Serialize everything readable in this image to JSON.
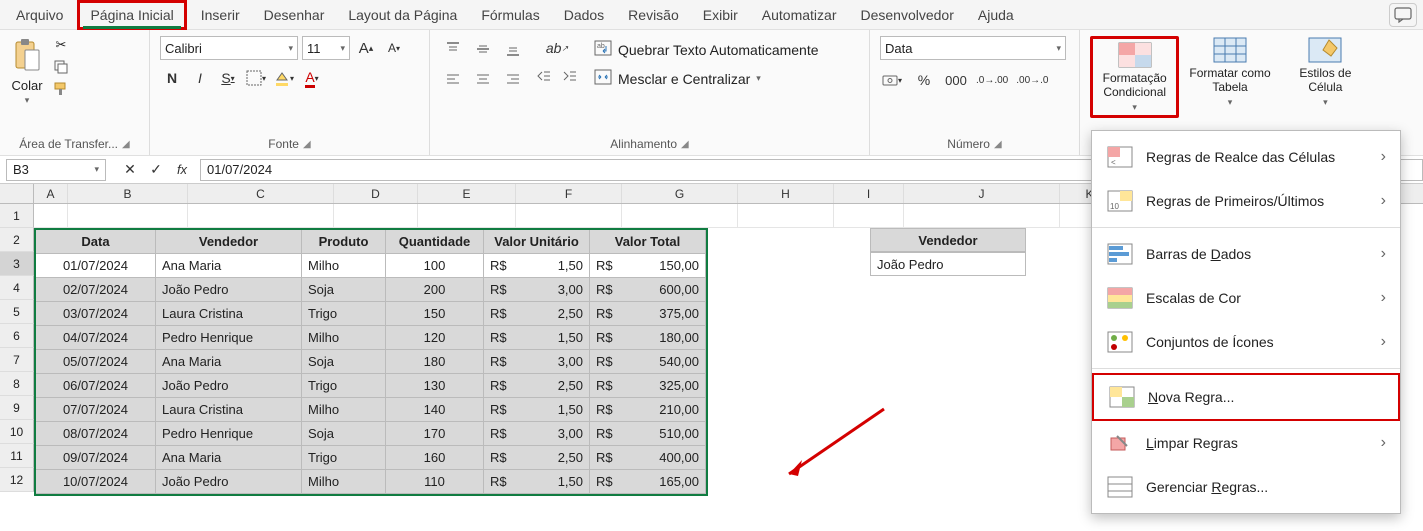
{
  "menu": {
    "items": [
      "Arquivo",
      "Página Inicial",
      "Inserir",
      "Desenhar",
      "Layout da Página",
      "Fórmulas",
      "Dados",
      "Revisão",
      "Exibir",
      "Automatizar",
      "Desenvolvedor",
      "Ajuda"
    ],
    "active_index": 1
  },
  "ribbon": {
    "clipboard": {
      "paste": "Colar",
      "group": "Área de Transfer..."
    },
    "font": {
      "name": "Calibri",
      "size": "11",
      "group": "Fonte"
    },
    "alignment": {
      "wrap": "Quebrar Texto Automaticamente",
      "merge": "Mesclar e Centralizar",
      "group": "Alinhamento"
    },
    "number": {
      "format": "Data",
      "group": "Número"
    },
    "styles": {
      "cond": "Formatação Condicional",
      "table": "Formatar como Tabela",
      "cell": "Estilos de Célula"
    }
  },
  "cf_menu": {
    "highlight": "Regras de Realce das Células",
    "toprules": "Regras de Primeiros/Últimos",
    "databars_pre": "Barras de ",
    "databars_m": "D",
    "databars_post": "ados",
    "scales": "Escalas de Cor",
    "icons": "Conjuntos de Ícones",
    "newrule_m": "N",
    "newrule_post": "ova Regra...",
    "clear_m": "L",
    "clear_post": "impar Regras",
    "manage_pre": "Gerenciar ",
    "manage_m": "R",
    "manage_post": "egras..."
  },
  "formula_bar": {
    "cell_ref": "B3",
    "value": "01/07/2024"
  },
  "columns": [
    "A",
    "B",
    "C",
    "D",
    "E",
    "F",
    "G",
    "H",
    "I",
    "J",
    "K"
  ],
  "row_count": 12,
  "table": {
    "headers": [
      "Data",
      "Vendedor",
      "Produto",
      "Quantidade",
      "Valor Unitário",
      "Valor Total"
    ],
    "currency": "R$",
    "rows": [
      {
        "d": "01/07/2024",
        "v": "Ana Maria",
        "p": "Milho",
        "q": "100",
        "u": "1,50",
        "t": "150,00",
        "white": true
      },
      {
        "d": "02/07/2024",
        "v": "João Pedro",
        "p": "Soja",
        "q": "200",
        "u": "3,00",
        "t": "600,00"
      },
      {
        "d": "03/07/2024",
        "v": "Laura Cristina",
        "p": "Trigo",
        "q": "150",
        "u": "2,50",
        "t": "375,00"
      },
      {
        "d": "04/07/2024",
        "v": "Pedro Henrique",
        "p": "Milho",
        "q": "120",
        "u": "1,50",
        "t": "180,00"
      },
      {
        "d": "05/07/2024",
        "v": "Ana Maria",
        "p": "Soja",
        "q": "180",
        "u": "3,00",
        "t": "540,00"
      },
      {
        "d": "06/07/2024",
        "v": "João Pedro",
        "p": "Trigo",
        "q": "130",
        "u": "2,50",
        "t": "325,00"
      },
      {
        "d": "07/07/2024",
        "v": "Laura Cristina",
        "p": "Milho",
        "q": "140",
        "u": "1,50",
        "t": "210,00"
      },
      {
        "d": "08/07/2024",
        "v": "Pedro Henrique",
        "p": "Soja",
        "q": "170",
        "u": "3,00",
        "t": "510,00"
      },
      {
        "d": "09/07/2024",
        "v": "Ana Maria",
        "p": "Trigo",
        "q": "160",
        "u": "2,50",
        "t": "400,00"
      },
      {
        "d": "10/07/2024",
        "v": "João Pedro",
        "p": "Milho",
        "q": "110",
        "u": "1,50",
        "t": "165,00"
      }
    ]
  },
  "side": {
    "header": "Vendedor",
    "value": "João Pedro"
  }
}
